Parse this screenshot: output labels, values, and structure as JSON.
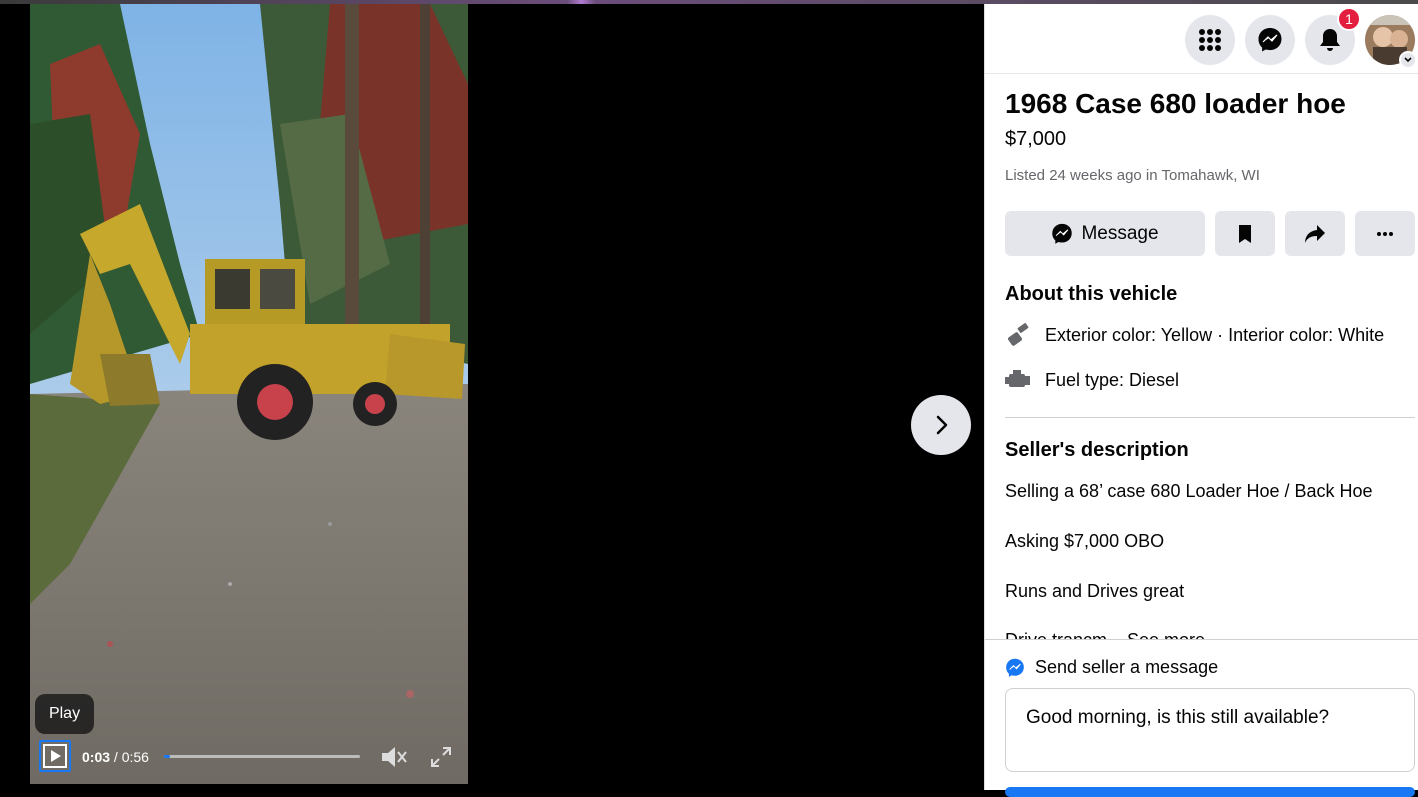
{
  "viewer": {
    "tooltip": "Play",
    "time_current": "0:03",
    "time_separator": " / ",
    "time_total": "0:56",
    "progress_fraction": 0.03
  },
  "topbar": {
    "notification_count": "1"
  },
  "listing": {
    "title": "1968 Case 680 loader hoe",
    "price": "$7,000",
    "listed_prefix": "Listed 24 weeks ago in ",
    "location": "Tomahawk, WI",
    "message_button": "Message"
  },
  "about": {
    "heading": "About this vehicle",
    "color": "Exterior color: Yellow · Interior color: White",
    "fuel": "Fuel type: Diesel"
  },
  "description": {
    "heading": "Seller's description",
    "lines": [
      "Selling a 68’ case 680 Loader Hoe / Back Hoe",
      "Asking $7,000 OBO",
      "Runs and Drives great",
      "Drive trancm... See more"
    ]
  },
  "footer": {
    "send_label": "Send seller a message",
    "message_value": "Good morning, is this still available?"
  },
  "colors": {
    "accent": "#1877f2",
    "badge": "#e41e3f",
    "button_grey": "#e4e6eb"
  }
}
